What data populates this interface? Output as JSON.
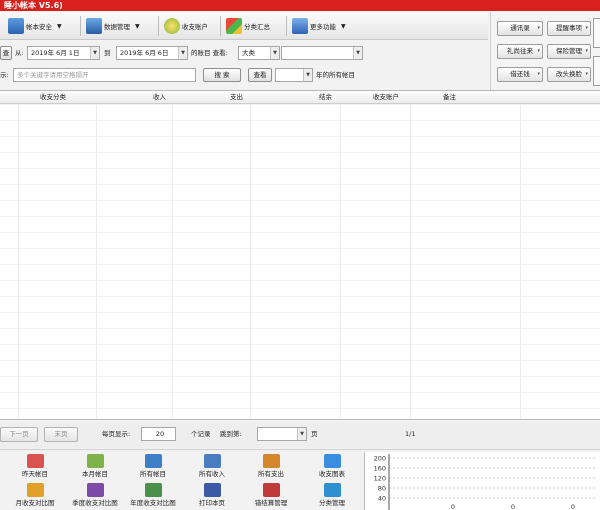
{
  "window": {
    "title": "睡小帐本 V5.6)"
  },
  "toolbar": {
    "buttons": [
      {
        "label": "帐本安全",
        "dropdown": "▼"
      },
      {
        "label": "数据管理",
        "dropdown": "▼"
      },
      {
        "label": "收支账户",
        "dropdown": ""
      },
      {
        "label": "分类汇总",
        "dropdown": ""
      },
      {
        "label": "更多功能",
        "dropdown": "▼"
      }
    ]
  },
  "right_panel": {
    "buttons": [
      "通讯录",
      "提醒事项",
      "礼尚往来",
      "保险管理",
      "借还钱",
      "改头换脸"
    ]
  },
  "filter": {
    "left_btn": "查",
    "from_label": "从:",
    "from_date": "2019年 6月 1日",
    "to_label": "到",
    "to_date": "2019年 6月 6日",
    "range_label": "的账目 查看:",
    "category": "大类",
    "subcategory": ""
  },
  "search": {
    "label": "示:",
    "placeholder": "多个关键字请用空格隔开",
    "search_btn": "搜 索",
    "view_btn": "查看",
    "year_value": "",
    "year_suffix": "年的所有帐目"
  },
  "table": {
    "columns": [
      "收支分类",
      "收入",
      "支出",
      "结余",
      "收支账户",
      "备注"
    ]
  },
  "pager": {
    "prev": "下一页",
    "last": "末页",
    "per_page_label": "每页显示:",
    "per_page_value": "20",
    "records_label": "个记录",
    "jump_label": "跳到第:",
    "jump_value": "",
    "page_suffix": "页",
    "page_info": "1/1"
  },
  "bottom_buttons": [
    {
      "label": "昨天帐目",
      "icon": "notebook-icon",
      "color": "#d9534f"
    },
    {
      "label": "本月帐目",
      "icon": "ledger-icon",
      "color": "#7fb24a"
    },
    {
      "label": "所有帐目",
      "icon": "books-icon",
      "color": "#3f7fc6"
    },
    {
      "label": "所有收入",
      "icon": "users-icon",
      "color": "#4a7dc0"
    },
    {
      "label": "所有支出",
      "icon": "people-icon",
      "color": "#d4862b"
    },
    {
      "label": "收支图表",
      "icon": "pie-chart-icon",
      "color": "#3a8ee0"
    },
    {
      "label": "月收支对比图",
      "icon": "bar-chart-icon",
      "color": "#e0a02a"
    },
    {
      "label": "季度收支对比图",
      "icon": "chart-icon",
      "color": "#7d4aa8"
    },
    {
      "label": "年度收支对比图",
      "icon": "grid-chart-icon",
      "color": "#4a8f4a"
    },
    {
      "label": "打印本页",
      "icon": "printer-icon",
      "color": "#3a5aa8"
    },
    {
      "label": "错结算管理",
      "icon": "tools-icon",
      "color": "#c03a3a"
    },
    {
      "label": "分类管理",
      "icon": "folder-icon",
      "color": "#2f8fd0"
    }
  ],
  "chart_data": {
    "type": "line",
    "y_ticks": [
      200,
      160,
      120,
      80,
      40
    ],
    "x_tick_labels": [
      "0",
      "0",
      "0"
    ],
    "series": []
  }
}
